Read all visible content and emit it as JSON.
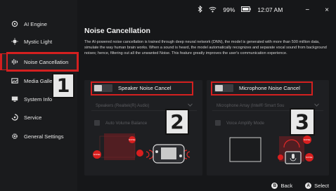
{
  "sidebar": {
    "items": [
      {
        "label": "AI Engine",
        "icon": "ai-engine-icon"
      },
      {
        "label": "Mystic Light",
        "icon": "light-icon"
      },
      {
        "label": "Noise Cancellation",
        "icon": "audio-wave-icon",
        "active": true
      },
      {
        "label": "Media Galle",
        "icon": "image-icon"
      },
      {
        "label": "System Info",
        "icon": "monitor-icon"
      },
      {
        "label": "Service",
        "icon": "service-icon"
      },
      {
        "label": "General Settings",
        "icon": "gear-icon"
      }
    ]
  },
  "status": {
    "bluetooth_icon": "bluetooth-icon",
    "wifi_icon": "wifi-icon",
    "battery": "99%",
    "time": "12:07 AM",
    "minimize": "−",
    "close": "×"
  },
  "page": {
    "title": "Noise Cancellation",
    "description": "The AI-powered noise cancellation is trained through deep neural network (DNN), the model is generated with more than 500 million data, simulate the way human brain works. When a sound is heard, the model automatically recognizes and separate vocal sound from background noises; hence, filtering out all the unwanted Noise. This feature greatly improves the user's communication experience."
  },
  "speaker": {
    "toggle_label": "Speaker Noise Cancel",
    "device": "Speakers (Realtek(R) Audio)",
    "option_label": "Auto Volume Balance",
    "illustration": [
      "NOISE",
      "NOISE"
    ]
  },
  "microphone": {
    "toggle_label": "Microphone Noise Cancel",
    "device": "Microphone Array (Intel® Smart Sou",
    "option_label": "Voice Amplify Mode",
    "illustration": [
      "NOISE",
      "NOISE"
    ]
  },
  "annotations": [
    "1",
    "2",
    "3"
  ],
  "footer": {
    "back_key": "B",
    "back_label": "Back",
    "select_key": "A",
    "select_label": "Select"
  },
  "colors": {
    "accent": "#d21f1f",
    "background": "#161719",
    "sidebar": "#1a1b1d"
  }
}
